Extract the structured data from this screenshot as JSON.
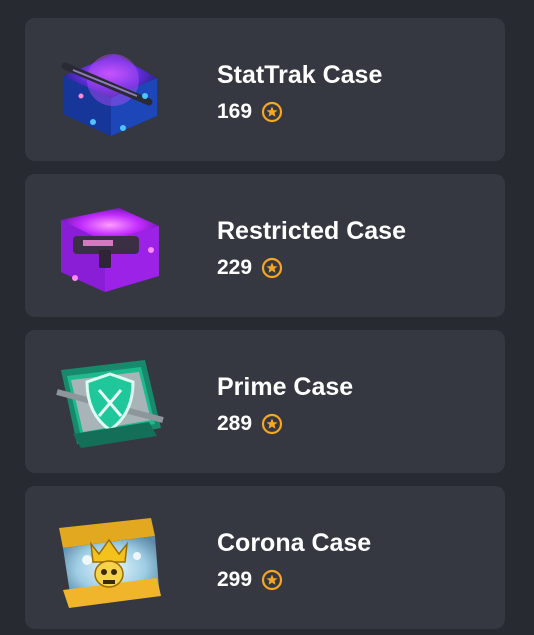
{
  "cases": [
    {
      "name": "StatTrak Case",
      "price": "169",
      "icon": "stattrak-case-icon",
      "accent": "#7b3cff"
    },
    {
      "name": "Restricted Case",
      "price": "229",
      "icon": "restricted-case-icon",
      "accent": "#c12cff"
    },
    {
      "name": "Prime Case",
      "price": "289",
      "icon": "prime-case-icon",
      "accent": "#22c99a"
    },
    {
      "name": "Corona Case",
      "price": "299",
      "icon": "corona-case-icon",
      "accent": "#f0b52a"
    }
  ],
  "currency": {
    "icon": "coin-star-icon",
    "color": "#f5a623"
  }
}
